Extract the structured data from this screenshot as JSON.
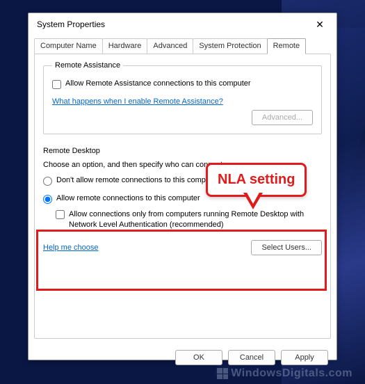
{
  "dialog": {
    "title": "System Properties",
    "tabs": [
      "Computer Name",
      "Hardware",
      "Advanced",
      "System Protection",
      "Remote"
    ],
    "active_tab_index": 4
  },
  "remote_assistance": {
    "legend": "Remote Assistance",
    "checkbox_label": "Allow Remote Assistance connections to this computer",
    "link": "What happens when I enable Remote Assistance?",
    "advanced_btn": "Advanced..."
  },
  "remote_desktop": {
    "heading": "Remote Desktop",
    "desc": "Choose an option, and then specify who can connect.",
    "radio_deny": "Don't allow remote connections to this computer",
    "radio_allow": "Allow remote connections to this computer",
    "nla_checkbox": "Allow connections only from computers running Remote Desktop with Network Level Authentication (recommended)",
    "help_link": "Help me choose",
    "select_users_btn": "Select Users..."
  },
  "buttons": {
    "ok": "OK",
    "cancel": "Cancel",
    "apply": "Apply"
  },
  "annotation": {
    "callout": "NLA setting"
  },
  "watermark": "WindowsDigitals.com"
}
